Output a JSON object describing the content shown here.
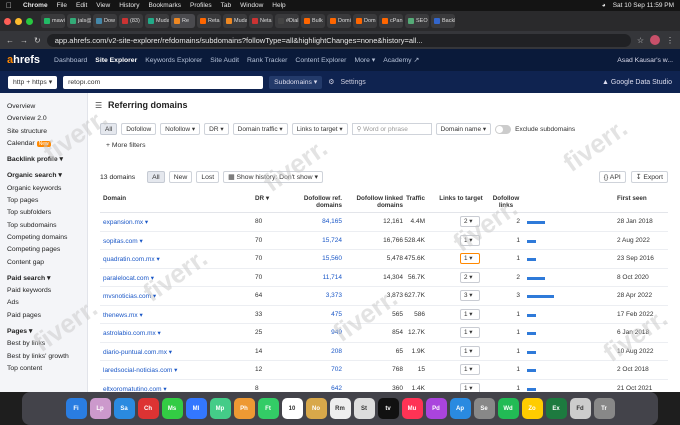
{
  "menubar": {
    "app": "Chrome",
    "items": [
      "File",
      "Edit",
      "View",
      "History",
      "Bookmarks",
      "Profiles",
      "Tab",
      "Window",
      "Help"
    ],
    "clock": "Sat 10 Sep  11:59 PM"
  },
  "tabs": [
    "mawi",
    "jals@",
    "Dow",
    "(83)",
    "Muda",
    "Re",
    "Reta",
    "Muda",
    "Neta",
    "#Dial",
    "Bulk",
    "Domi",
    "Dom",
    "cPan",
    "SEO",
    "Backl"
  ],
  "address": {
    "url": "app.ahrefs.com/v2-site-explorer/refdomains/subdomains?followType=all&highlightChanges=none&history=all..."
  },
  "nav": {
    "logo_a": "a",
    "logo_rest": "hrefs",
    "items": [
      "Dashboard",
      "Site Explorer",
      "Keywords Explorer",
      "Site Audit",
      "Rank Tracker",
      "Content Explorer",
      "More ▾",
      "Academy ↗"
    ],
    "account": "Asad Kausar's w..."
  },
  "subnav": {
    "protocol": "http + https ▾",
    "target": "retopı.com",
    "mode": "Subdomains ▾",
    "settings": "Settings",
    "gds": "Google Data Studio"
  },
  "sidebar": {
    "top": [
      "Overview",
      "Overview 2.0",
      "Site structure",
      "Calendar"
    ],
    "calendar_badge": "New",
    "backlink": "Backlink profile ▾",
    "organic": "Organic search ▾",
    "organic_items": [
      "Organic keywords",
      "Top pages",
      "Top subfolders",
      "Top subdomains",
      "Competing domains",
      "Competing pages",
      "Content gap"
    ],
    "paid": "Paid search ▾",
    "paid_items": [
      "Paid keywords",
      "Ads",
      "Paid pages"
    ],
    "pages": "Pages ▾",
    "pages_items": [
      "Best by links",
      "Best by links' growth",
      "Top content"
    ]
  },
  "page": {
    "title": "Referring domains"
  },
  "filters": {
    "all": "All",
    "dofollow": "Dofollow",
    "nofollow": "Nofollow ▾",
    "dr": "DR ▾",
    "domain_traffic": "Domain traffic ▾",
    "links_to_target": "Links to target ▾",
    "search_placeholder": "Word or phrase",
    "domain_name": "Domain name ▾",
    "exclude": "Exclude subdomains",
    "more": "+  More filters"
  },
  "toolbar": {
    "count": "13 domains",
    "all": "All",
    "new": "New",
    "lost": "Lost",
    "history": "Show history: Don't show ▾",
    "api": "{} API",
    "export": "Export"
  },
  "columns": {
    "domain": "Domain",
    "dr": "DR ▾",
    "dofollow_ref": "Dofollow ref. domains",
    "dofollow_linked": "Dofollow linked domains",
    "traffic": "Traffic",
    "links": "Links to target",
    "dofollow_links": "Dofollow links",
    "first_seen": "First seen"
  },
  "rows": [
    {
      "domain": "expansion.mx ▾",
      "dr": "80",
      "ref": "84,165",
      "linked": "12,161",
      "traffic": "4.4M",
      "links": "2 ▾",
      "dlinks": "2",
      "bar": 0.45,
      "first": "28 Jan 2018"
    },
    {
      "domain": "sopitas.com ▾",
      "dr": "70",
      "ref": "15,724",
      "linked": "16,766",
      "traffic": "528.4K",
      "links": "1 ▾",
      "dlinks": "1",
      "bar": 0.22,
      "first": "2 Aug 2022"
    },
    {
      "domain": "quadratin.com.mx ▾",
      "dr": "70",
      "ref": "15,560",
      "linked": "5,478",
      "traffic": "475.6K",
      "links": "1 ▾",
      "dlinks": "1",
      "bar": 0.22,
      "first": "23 Sep 2016"
    },
    {
      "domain": "paralelocat.com ▾",
      "dr": "70",
      "ref": "11,714",
      "linked": "14,304",
      "traffic": "56.7K",
      "links": "2 ▾",
      "dlinks": "2",
      "bar": 0.45,
      "first": "8 Oct 2020"
    },
    {
      "domain": "mvsnoticias.com ▾",
      "dr": "64",
      "ref": "3,373",
      "linked": "3,873",
      "traffic": "627.7K",
      "links": "3 ▾",
      "dlinks": "3",
      "bar": 0.68,
      "first": "28 Apr 2022"
    },
    {
      "domain": "thenews.mx ▾",
      "dr": "33",
      "ref": "475",
      "linked": "565",
      "traffic": "586",
      "links": "1 ▾",
      "dlinks": "1",
      "bar": 0.22,
      "first": "17 Feb 2022"
    },
    {
      "domain": "astrolabio.com.mx ▾",
      "dr": "25",
      "ref": "949",
      "linked": "854",
      "traffic": "12.7K",
      "links": "1 ▾",
      "dlinks": "1",
      "bar": 0.22,
      "first": "6 Jan 2018"
    },
    {
      "domain": "diario-puntual.com.mx ▾",
      "dr": "14",
      "ref": "208",
      "linked": "65",
      "traffic": "1.9K",
      "links": "1 ▾",
      "dlinks": "1",
      "bar": 0.22,
      "first": "10 Aug 2022"
    },
    {
      "domain": "laredsocial-noticias.com ▾",
      "dr": "12",
      "ref": "702",
      "linked": "768",
      "traffic": "15",
      "links": "1 ▾",
      "dlinks": "1",
      "bar": 0.22,
      "first": "2 Oct 2018"
    },
    {
      "domain": "eltxoromatutino.com ▾",
      "dr": "8",
      "ref": "642",
      "linked": "360",
      "traffic": "1.4K",
      "links": "1 ▾",
      "dlinks": "1",
      "bar": 0.22,
      "first": "21 Oct 2021"
    }
  ],
  "dock": [
    "Fi",
    "Lp",
    "Sa",
    "Ch",
    "Ms",
    "Ml",
    "Mp",
    "Ph",
    "Ft",
    "10",
    "No",
    "Rm",
    "St",
    "tv",
    "Mu",
    "Pd",
    "Ap",
    "Se",
    "Wd",
    "Zo",
    "Ex",
    "Fd",
    "Tr"
  ],
  "watermark": "fiverr."
}
